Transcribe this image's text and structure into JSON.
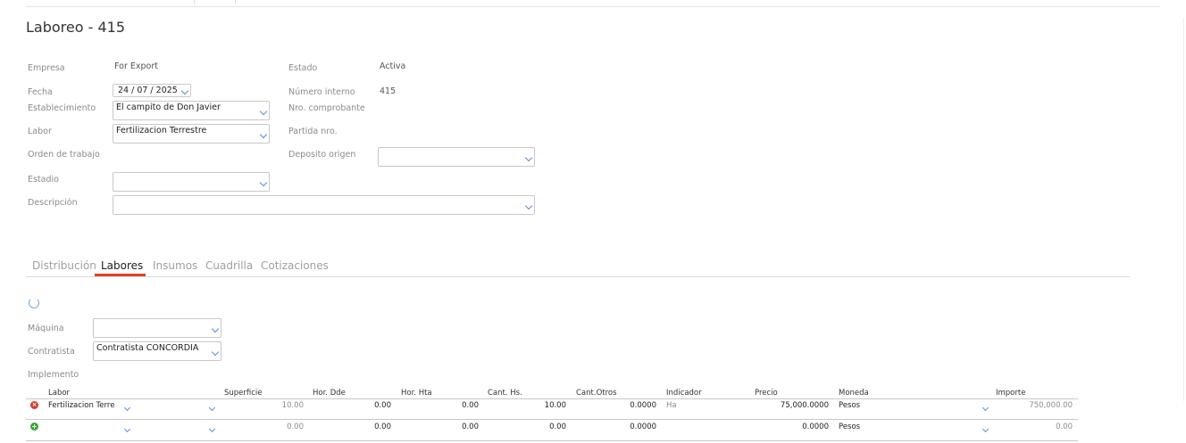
{
  "page": {
    "title": "Laboreo - 415"
  },
  "form": {
    "empresa_label": "Empresa",
    "empresa_value": "For Export",
    "estado_label": "Estado",
    "estado_value": "Activa",
    "fecha_label": "Fecha",
    "fecha_value": "24 / 07 / 2025",
    "numero_interno_label": "Número interno",
    "numero_interno_value": "415",
    "establecimiento_label": "Establecimiento",
    "establecimiento_value": "El campito de Don Javier",
    "nro_comprobante_label": "Nro. comprobante",
    "labor_label": "Labor",
    "labor_value": "Fertilizacion Terrestre",
    "partida_label": "Partida nro.",
    "orden_label": "Orden de trabajo",
    "deposito_label": "Deposito origen",
    "deposito_value": "",
    "estadio_label": "Estadio",
    "estadio_value": "",
    "descripcion_label": "Descripción",
    "descripcion_value": ""
  },
  "tabs": [
    {
      "label": "Distribución",
      "active": false
    },
    {
      "label": "Labores",
      "active": true
    },
    {
      "label": "Insumos",
      "active": false
    },
    {
      "label": "Cuadrilla",
      "active": false
    },
    {
      "label": "Cotizaciones",
      "active": false
    }
  ],
  "labores": {
    "maquina_label": "Máquina",
    "maquina_value": "",
    "contratista_label": "Contratista",
    "contratista_value": "Contratista CONCORDIA",
    "implemento_label": "Implemento"
  },
  "table": {
    "headers": {
      "labor": "Labor",
      "superficie": "Superficie",
      "hor_dde": "Hor. Dde",
      "hor_hta": "Hor. Hta",
      "cant_hs": "Cant. Hs.",
      "cant_otros": "Cant.Otros",
      "indicador": "Indicador",
      "precio": "Precio",
      "moneda": "Moneda",
      "importe": "Importe"
    },
    "rows": [
      {
        "labor": "Fertilizacion Terre",
        "superficie": "10.00",
        "hor_dde": "0.00",
        "hor_hta": "0.00",
        "cant_hs": "10.00",
        "cant_otros": "0.0000",
        "indicador": "Ha",
        "precio": "75,000.0000",
        "moneda": "Pesos",
        "importe": "750,000.00"
      },
      {
        "labor": "",
        "superficie": "0.00",
        "hor_dde": "0.00",
        "hor_hta": "0.00",
        "cant_hs": "0.00",
        "cant_otros": "0.0000",
        "indicador": "",
        "precio": "0.0000",
        "moneda": "Pesos",
        "importe": "0.00"
      }
    ]
  },
  "icons": {
    "refresh": "refresh-icon",
    "delete": "delete-row-icon",
    "add": "add-row-icon"
  },
  "colors": {
    "accent": "#e2402b",
    "link": "#5a8ed0"
  }
}
